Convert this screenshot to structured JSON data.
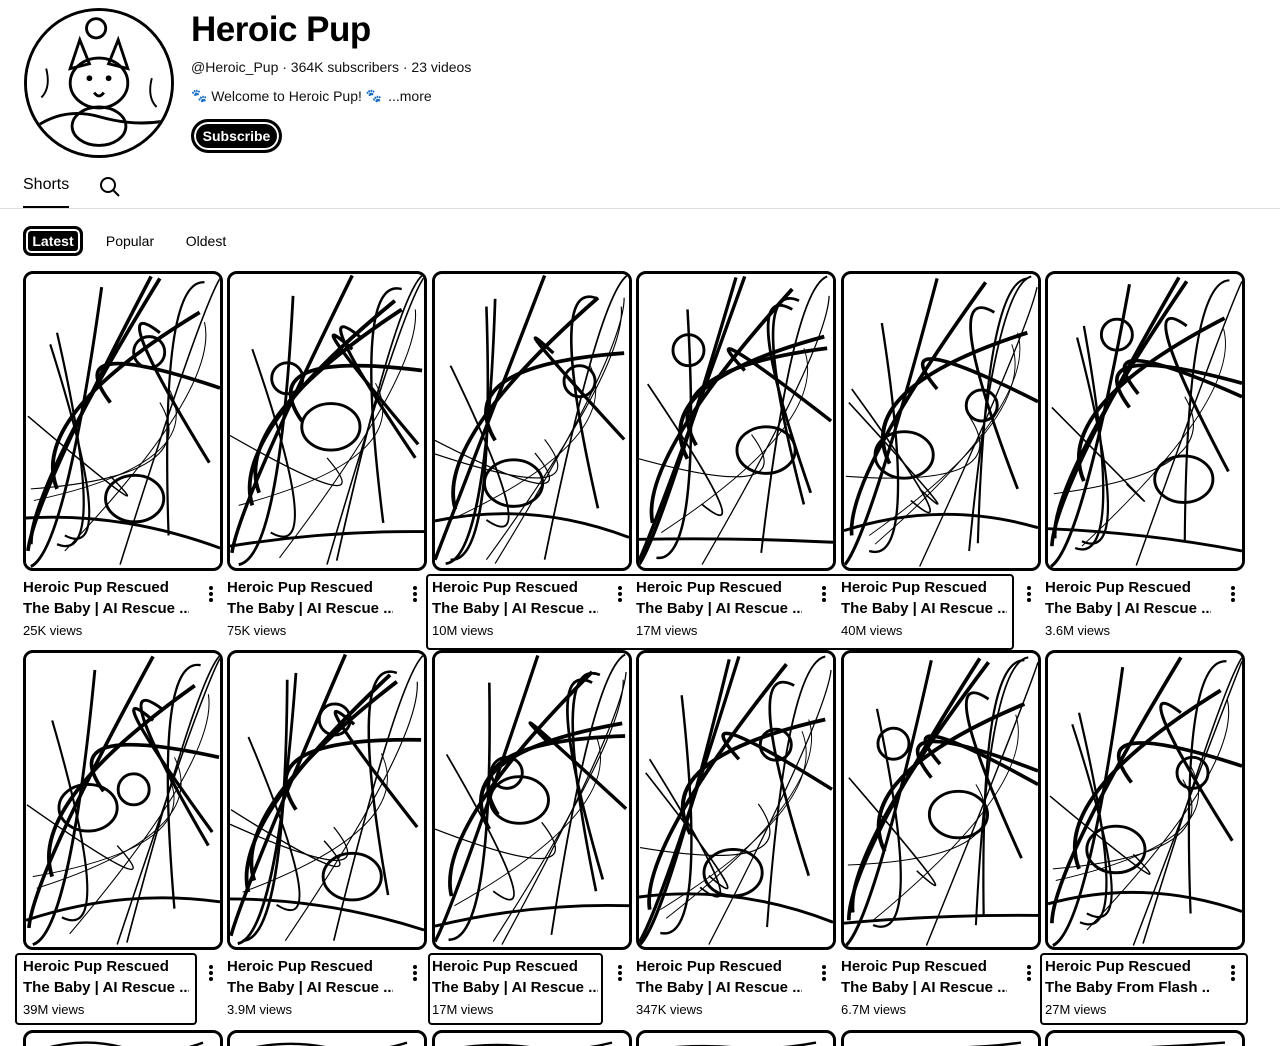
{
  "channel": {
    "name": "Heroic Pup",
    "meta": "@Heroic_Pup · 364K subscribers · 23 videos",
    "description": "Welcome to Heroic Pup!",
    "paw": "🐾",
    "more": "...more",
    "subscribe_label": "Subscribe"
  },
  "tabs": {
    "shorts": "Shorts"
  },
  "chips": {
    "latest": "Latest",
    "popular": "Popular",
    "oldest": "Oldest"
  },
  "videos": [
    {
      "l1": "Heroic Pup Rescued",
      "l2": "The Baby | AI Rescue ...",
      "views": "25K views"
    },
    {
      "l1": "Heroic Pup Rescued",
      "l2": "The Baby | AI Rescue ...",
      "views": "75K views"
    },
    {
      "l1": "Heroic Pup Rescued",
      "l2": "The Baby | AI Rescue ...",
      "views": "10M views"
    },
    {
      "l1": "Heroic Pup Rescued",
      "l2": "The Baby | AI Rescue ...",
      "views": "17M views"
    },
    {
      "l1": "Heroic Pup Rescued",
      "l2": "The Baby | AI Rescue ...",
      "views": "40M views"
    },
    {
      "l1": "Heroic Pup Rescued",
      "l2": "The Baby | AI Rescue ...",
      "views": "3.6M views"
    },
    {
      "l1": "Heroic Pup Rescued",
      "l2": "The Baby | AI Rescue ...",
      "views": "39M views"
    },
    {
      "l1": "Heroic Pup Rescued",
      "l2": "The Baby | AI Rescue ...",
      "views": "3.9M views"
    },
    {
      "l1": "Heroic Pup Rescued",
      "l2": "The Baby | AI Rescue ...",
      "views": "17M views"
    },
    {
      "l1": "Heroic Pup Rescued",
      "l2": "The Baby | AI Rescue ...",
      "views": "347K views"
    },
    {
      "l1": "Heroic Pup Rescued",
      "l2": "The Baby | AI Rescue ...",
      "views": "6.7M views"
    },
    {
      "l1": "Heroic Pup Rescued",
      "l2": "The Baby From Flash ...",
      "views": "27M views"
    }
  ]
}
